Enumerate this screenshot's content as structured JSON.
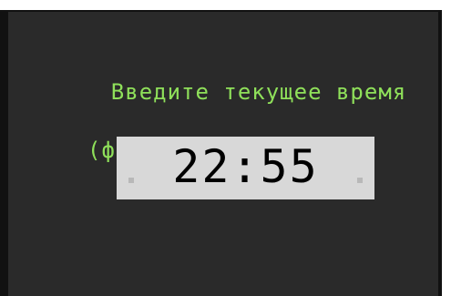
{
  "prompt": {
    "line1": "Введите текущее время",
    "line2": "(формат: чч:мм)"
  },
  "time_input": {
    "value": "22:55"
  },
  "colors": {
    "background": "#2a2a2a",
    "prompt_text": "#8fe05a",
    "field_background": "#d8d8d8",
    "field_text": "#000000"
  }
}
